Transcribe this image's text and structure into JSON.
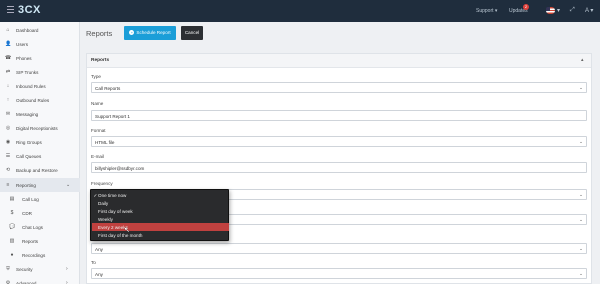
{
  "topbar": {
    "logo": "3CX",
    "support": "Support ▾",
    "updates": "Updates",
    "updates_badge": "2",
    "language": "▾",
    "expand": "⤢",
    "user": "A ▾"
  },
  "sidebar": {
    "items": [
      {
        "label": "Dashboard",
        "icon": "⌂"
      },
      {
        "label": "Users",
        "icon": "👤"
      },
      {
        "label": "Phones",
        "icon": "☎"
      },
      {
        "label": "SIP Trunks",
        "icon": "⇄"
      },
      {
        "label": "Inbound Rules",
        "icon": "↓"
      },
      {
        "label": "Outbound Rules",
        "icon": "↑"
      },
      {
        "label": "Messaging",
        "icon": "✉"
      },
      {
        "label": "Digital Receptionists",
        "icon": "◎"
      },
      {
        "label": "Ring Groups",
        "icon": "◉"
      },
      {
        "label": "Call Queues",
        "icon": "☰"
      },
      {
        "label": "Backup and Restore",
        "icon": "⟲"
      },
      {
        "label": "Reporting",
        "icon": "≡",
        "chevron": "⌄"
      },
      {
        "label": "Call Log",
        "icon": "▤"
      },
      {
        "label": "CDR",
        "icon": "$"
      },
      {
        "label": "Chat Logs",
        "icon": "💬"
      },
      {
        "label": "Reports",
        "icon": "▥"
      },
      {
        "label": "Recordings",
        "icon": "●"
      },
      {
        "label": "Security",
        "icon": "⛨",
        "chevron": "›"
      },
      {
        "label": "Advanced",
        "icon": "⚙",
        "chevron": "›"
      }
    ]
  },
  "header": {
    "title": "Reports",
    "schedule_button": "Schedule Report",
    "cancel_button": "Cancel"
  },
  "panel": {
    "title": "Reports",
    "collapse": "▴"
  },
  "form": {
    "type": {
      "label": "Type",
      "value": "Call Reports"
    },
    "name": {
      "label": "Name",
      "value": "Support Report 1"
    },
    "format": {
      "label": "Format",
      "value": "HTML file"
    },
    "email": {
      "label": "E-mail",
      "value": "billyshipler@ssdbyr.com"
    },
    "frequency": {
      "label": "Frequency",
      "value": ""
    },
    "row_after": {
      "value": ""
    },
    "from_value": "Any",
    "to": {
      "label": "To",
      "value": "Any"
    }
  },
  "frequency_dropdown": {
    "options": [
      {
        "label": "One time now",
        "selected": true
      },
      {
        "label": "Daily"
      },
      {
        "label": "First day of week"
      },
      {
        "label": "Weekly"
      },
      {
        "label": "Every 2 weeks",
        "highlighted": true
      },
      {
        "label": "First day of the month"
      }
    ],
    "check": "✓"
  },
  "colors": {
    "topbar": "#1f2d3d",
    "accent": "#1b9ed8",
    "highlight": "#c0413f",
    "dropdown_bg": "#2a2b2d"
  }
}
